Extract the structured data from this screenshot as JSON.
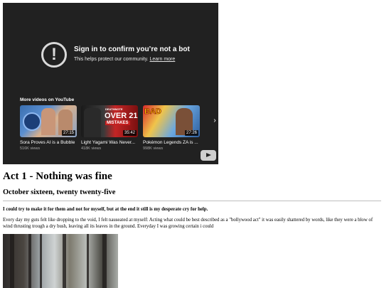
{
  "embed": {
    "message_title": "Sign in to confirm you’re not a bot",
    "message_sub": "This helps protect our community.",
    "learn_more": "Learn more",
    "more_videos": "More videos on YouTube",
    "videos": [
      {
        "title": "Sora Proves AI is a Bubble",
        "views": "516K views",
        "duration": "27:15"
      },
      {
        "title": "Light Yagami Was Never...",
        "views": "418K views",
        "duration": "35:42",
        "overlay": "OVER 21",
        "overlay_small": "DEATHNOTE",
        "overlay_sub": "MISTAKES"
      },
      {
        "title": "Pokémon Legends ZA is ...",
        "views": "998K views",
        "duration": "27:26",
        "overlay": "BAD"
      }
    ],
    "colors": {
      "background": "#212121",
      "text": "#ffffff",
      "meta": "#aaaaaa"
    }
  },
  "article": {
    "title": "Act 1 - Nothing was fine",
    "date": "October sixteen, twenty twenty-five",
    "lead": "I could try to make it for them and not for myself, but at the end it still is my desperate cry for help.",
    "paragraph": "Every day my guts felt like dropping to the void, I felt nauseated at myself: Acting what could be best described as a \"bollywood act\" it was easily shattered by words, like they were a blow of wind thrusting trough a dry bush, leaving all its leaves in the ground. Everyday I was growing certain i could"
  }
}
